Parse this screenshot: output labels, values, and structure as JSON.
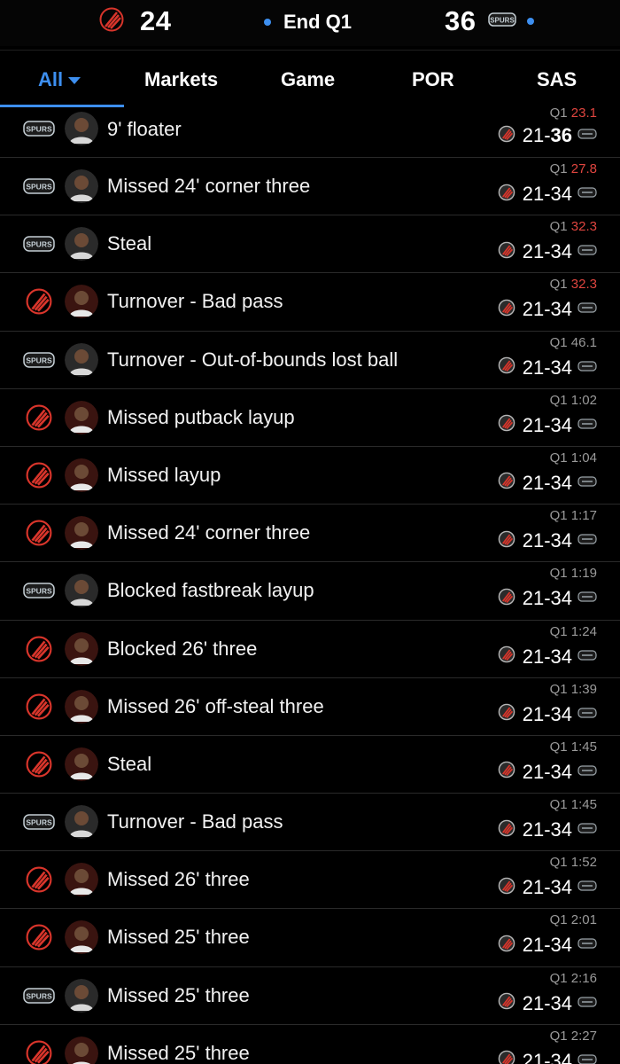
{
  "header": {
    "home_score": "24",
    "away_score": "36",
    "status": "End Q1",
    "away_logo_text": "SPURS"
  },
  "tabs": [
    {
      "label": "All"
    },
    {
      "label": "Markets"
    },
    {
      "label": "Game"
    },
    {
      "label": "POR"
    },
    {
      "label": "SAS"
    }
  ],
  "colors": {
    "accent": "#3d8ff0",
    "clock_red": "#e0453f",
    "por_red": "#d9352b",
    "spurs_gray": "#c4ced4"
  },
  "plays": [
    {
      "team": "SAS",
      "desc": "9' floater",
      "period": "Q1",
      "clock": "23.1",
      "clock_red": true,
      "home": "21",
      "away": "36",
      "away_bold": true
    },
    {
      "team": "SAS",
      "desc": "Missed 24' corner three",
      "period": "Q1",
      "clock": "27.8",
      "clock_red": true,
      "home": "21",
      "away": "34"
    },
    {
      "team": "SAS",
      "desc": "Steal",
      "period": "Q1",
      "clock": "32.3",
      "clock_red": true,
      "home": "21",
      "away": "34"
    },
    {
      "team": "POR",
      "desc": "Turnover - Bad pass",
      "period": "Q1",
      "clock": "32.3",
      "clock_red": true,
      "home": "21",
      "away": "34"
    },
    {
      "team": "SAS",
      "desc": "Turnover - Out-of-bounds lost ball",
      "period": "Q1",
      "clock": "46.1",
      "clock_red": false,
      "home": "21",
      "away": "34"
    },
    {
      "team": "POR",
      "desc": "Missed putback layup",
      "period": "Q1",
      "clock": "1:02",
      "clock_red": false,
      "home": "21",
      "away": "34"
    },
    {
      "team": "POR",
      "desc": "Missed layup",
      "period": "Q1",
      "clock": "1:04",
      "clock_red": false,
      "home": "21",
      "away": "34"
    },
    {
      "team": "POR",
      "desc": "Missed 24' corner three",
      "period": "Q1",
      "clock": "1:17",
      "clock_red": false,
      "home": "21",
      "away": "34"
    },
    {
      "team": "SAS",
      "desc": "Blocked fastbreak layup",
      "period": "Q1",
      "clock": "1:19",
      "clock_red": false,
      "home": "21",
      "away": "34"
    },
    {
      "team": "POR",
      "desc": "Blocked 26' three",
      "period": "Q1",
      "clock": "1:24",
      "clock_red": false,
      "home": "21",
      "away": "34"
    },
    {
      "team": "POR",
      "desc": "Missed 26' off-steal three",
      "period": "Q1",
      "clock": "1:39",
      "clock_red": false,
      "home": "21",
      "away": "34"
    },
    {
      "team": "POR",
      "desc": "Steal",
      "period": "Q1",
      "clock": "1:45",
      "clock_red": false,
      "home": "21",
      "away": "34"
    },
    {
      "team": "SAS",
      "desc": "Turnover - Bad pass",
      "period": "Q1",
      "clock": "1:45",
      "clock_red": false,
      "home": "21",
      "away": "34"
    },
    {
      "team": "POR",
      "desc": "Missed 26' three",
      "period": "Q1",
      "clock": "1:52",
      "clock_red": false,
      "home": "21",
      "away": "34"
    },
    {
      "team": "POR",
      "desc": "Missed 25' three",
      "period": "Q1",
      "clock": "2:01",
      "clock_red": false,
      "home": "21",
      "away": "34"
    },
    {
      "team": "SAS",
      "desc": "Missed 25' three",
      "period": "Q1",
      "clock": "2:16",
      "clock_red": false,
      "home": "21",
      "away": "34"
    },
    {
      "team": "POR",
      "desc": "Missed 25' three",
      "period": "Q1",
      "clock": "2:27",
      "clock_red": false,
      "home": "21",
      "away": "34"
    }
  ]
}
